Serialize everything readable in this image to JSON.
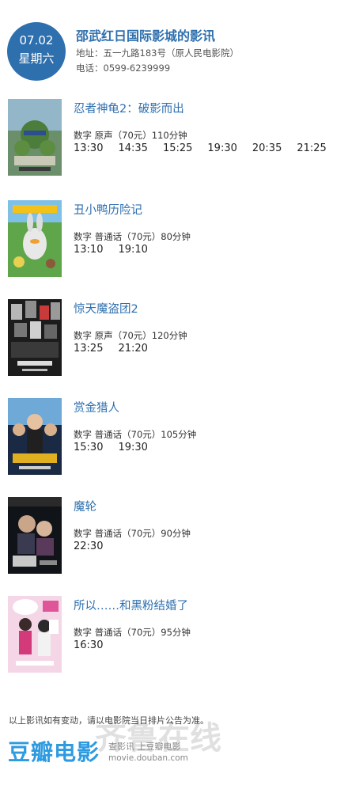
{
  "header": {
    "date": "07.02",
    "weekday": "星期六",
    "cinema_name": "邵武红日国际影城的影讯",
    "address": "地址：五一九路183号（原人民电影院）",
    "phone": "电话：0599-6239999"
  },
  "movies": [
    {
      "title": "忍者神龟2：破影而出",
      "info": "数字 原声（70元）110分钟",
      "times": [
        "13:30",
        "14:35",
        "15:25",
        "19:30",
        "20:35",
        "21:25"
      ],
      "poster_icon": "ninja-turtles-poster"
    },
    {
      "title": "丑小鸭历险记",
      "info": "数字 普通话（70元）80分钟",
      "times": [
        "13:10",
        "19:10"
      ],
      "poster_icon": "ugly-duckling-poster"
    },
    {
      "title": "惊天魔盗团2",
      "info": "数字 原声（70元）120分钟",
      "times": [
        "13:25",
        "21:20"
      ],
      "poster_icon": "now-you-see-me-poster"
    },
    {
      "title": "赏金猎人",
      "info": "数字 普通话（70元）105分钟",
      "times": [
        "15:30",
        "19:30"
      ],
      "poster_icon": "bounty-hunters-poster"
    },
    {
      "title": "魔轮",
      "info": "数字 普通话（70元）90分钟",
      "times": [
        "22:30"
      ],
      "poster_icon": "mo-lun-poster"
    },
    {
      "title": "所以……和黑粉结婚了",
      "info": "数字 普通话（70元）95分钟",
      "times": [
        "16:30"
      ],
      "poster_icon": "married-to-anti-fan-poster"
    }
  ],
  "footer": {
    "note": "以上影讯如有变动，请以电影院当日排片公告为准。",
    "logo": "豆瓣电影",
    "logo_sub1": "查影讯 上豆瓣电影",
    "logo_sub2": "movie.douban.com",
    "watermark": "齐鲁在线"
  },
  "colors": {
    "accent": "#2e6fae",
    "logo": "#2e9be0"
  }
}
